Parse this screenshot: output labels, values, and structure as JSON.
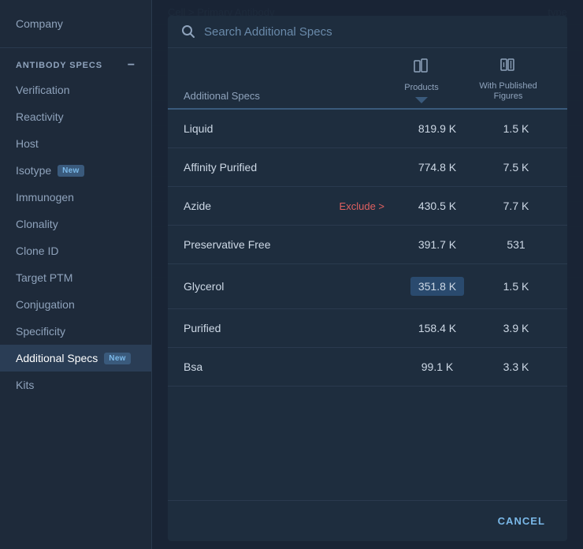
{
  "sidebar": {
    "company_label": "Company",
    "section_header": "ANTIBODY SPECS",
    "nav_items": [
      {
        "id": "verification",
        "label": "Verification",
        "active": false,
        "badge": null
      },
      {
        "id": "reactivity",
        "label": "Reactivity",
        "active": false,
        "badge": null
      },
      {
        "id": "host",
        "label": "Host",
        "active": false,
        "badge": null
      },
      {
        "id": "isotype",
        "label": "Isotype",
        "active": false,
        "badge": "New"
      },
      {
        "id": "immunogen",
        "label": "Immunogen",
        "active": false,
        "badge": null
      },
      {
        "id": "clonality",
        "label": "Clonality",
        "active": false,
        "badge": null
      },
      {
        "id": "clone-id",
        "label": "Clone ID",
        "active": false,
        "badge": null
      },
      {
        "id": "target-ptm",
        "label": "Target PTM",
        "active": false,
        "badge": null
      },
      {
        "id": "conjugation",
        "label": "Conjugation",
        "active": false,
        "badge": null
      },
      {
        "id": "specificity",
        "label": "Specificity",
        "active": false,
        "badge": null
      },
      {
        "id": "additional-specs",
        "label": "Additional Specs",
        "active": true,
        "badge": "New"
      },
      {
        "id": "kits",
        "label": "Kits",
        "active": false,
        "badge": null
      }
    ]
  },
  "modal": {
    "search_placeholder": "Search Additional Specs",
    "col_header_name": "Additional Specs",
    "col_header_products": "Products",
    "col_header_published": "With Published Figures",
    "rows": [
      {
        "name": "Liquid",
        "products": "819.9 K",
        "published": "1.5 K",
        "exclude": false,
        "highlight_products": false
      },
      {
        "name": "Affinity Purified",
        "products": "774.8 K",
        "published": "7.5 K",
        "exclude": false,
        "highlight_products": false
      },
      {
        "name": "Azide",
        "products": "430.5 K",
        "published": "7.7 K",
        "exclude": true,
        "highlight_products": false
      },
      {
        "name": "Preservative Free",
        "products": "391.7 K",
        "published": "531",
        "exclude": false,
        "highlight_products": false
      },
      {
        "name": "Glycerol",
        "products": "351.8 K",
        "published": "1.5 K",
        "exclude": false,
        "highlight_products": true
      },
      {
        "name": "Purified",
        "products": "158.4 K",
        "published": "3.9 K",
        "exclude": false,
        "highlight_products": false
      },
      {
        "name": "Bsa",
        "products": "99.1 K",
        "published": "3.3 K",
        "exclude": false,
        "highlight_products": false
      }
    ],
    "exclude_label": "Exclude >",
    "cancel_label": "CANCEL"
  }
}
